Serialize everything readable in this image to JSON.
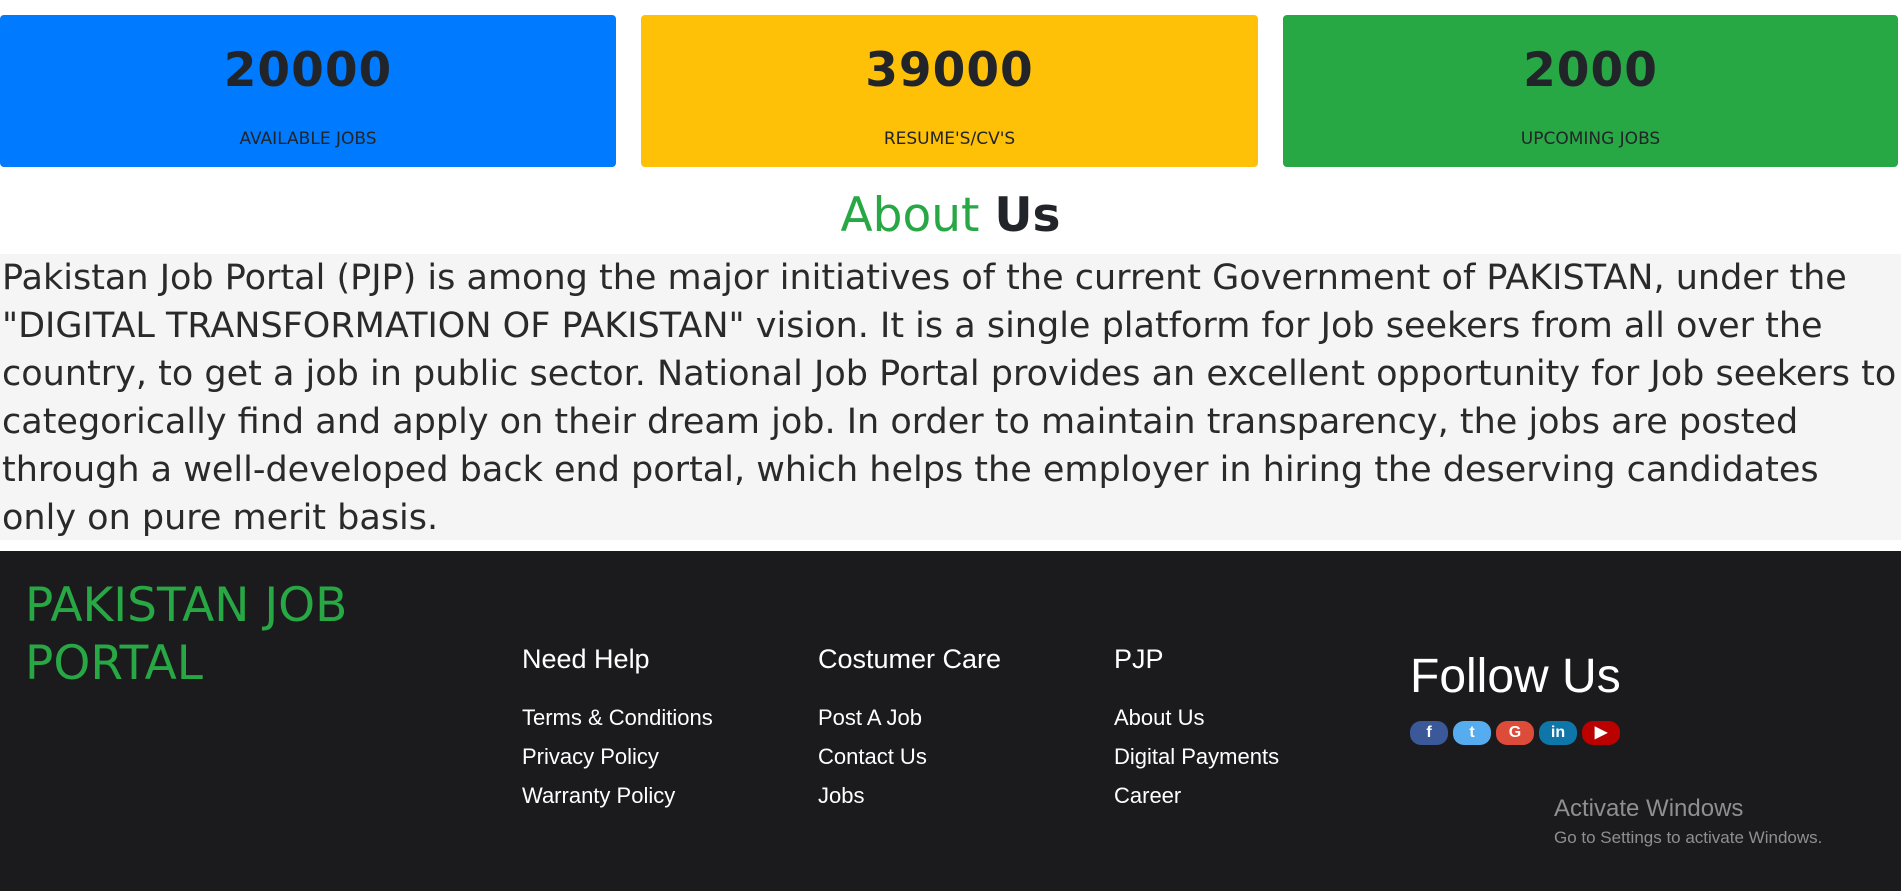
{
  "stats": [
    {
      "value": "20000",
      "label": "AVAILABLE JOBS",
      "color": "#007bff"
    },
    {
      "value": "39000",
      "label": "RESUME'S/CV'S",
      "color": "#ffc107"
    },
    {
      "value": "2000",
      "label": "UPCOMING JOBS",
      "color": "#28a745"
    }
  ],
  "about": {
    "title_part1": "About",
    "title_part2": "Us",
    "text": "Pakistan Job Portal (PJP) is among the major initiatives of the current Government of PAKISTAN, under the \"DIGITAL TRANSFORMATION OF PAKISTAN\" vision. It is a single platform for Job seekers from all over the country, to get a job in public sector. National Job Portal provides an excellent opportunity for Job seekers to categorically find and apply on their dream job. In order to maintain transparency, the jobs are posted through a well-developed back end portal, which helps the employer in hiring the deserving candidates only on pure merit basis."
  },
  "footer": {
    "brand": "PAKISTAN JOB PORTAL",
    "columns": [
      {
        "title": "Need Help",
        "links": [
          "Terms & Conditions",
          "Privacy Policy",
          "Warranty Policy"
        ]
      },
      {
        "title": "Costumer Care",
        "links": [
          "Post A Job",
          "Contact Us",
          "Jobs"
        ]
      },
      {
        "title": "PJP",
        "links": [
          "About Us",
          "Digital Payments",
          "Career"
        ]
      }
    ],
    "follow_title": "Follow Us",
    "social": [
      {
        "icon": "facebook-icon",
        "glyph": "f",
        "color": "#3b5998"
      },
      {
        "icon": "twitter-icon",
        "glyph": "t",
        "color": "#55acee"
      },
      {
        "icon": "google-icon",
        "glyph": "G",
        "color": "#dd4b39"
      },
      {
        "icon": "linkedin-icon",
        "glyph": "in",
        "color": "#0e76a8"
      },
      {
        "icon": "youtube-icon",
        "glyph": "▶",
        "color": "#bb0000"
      }
    ]
  },
  "watermark": {
    "line1": "Activate Windows",
    "line2": "Go to Settings to activate Windows."
  }
}
